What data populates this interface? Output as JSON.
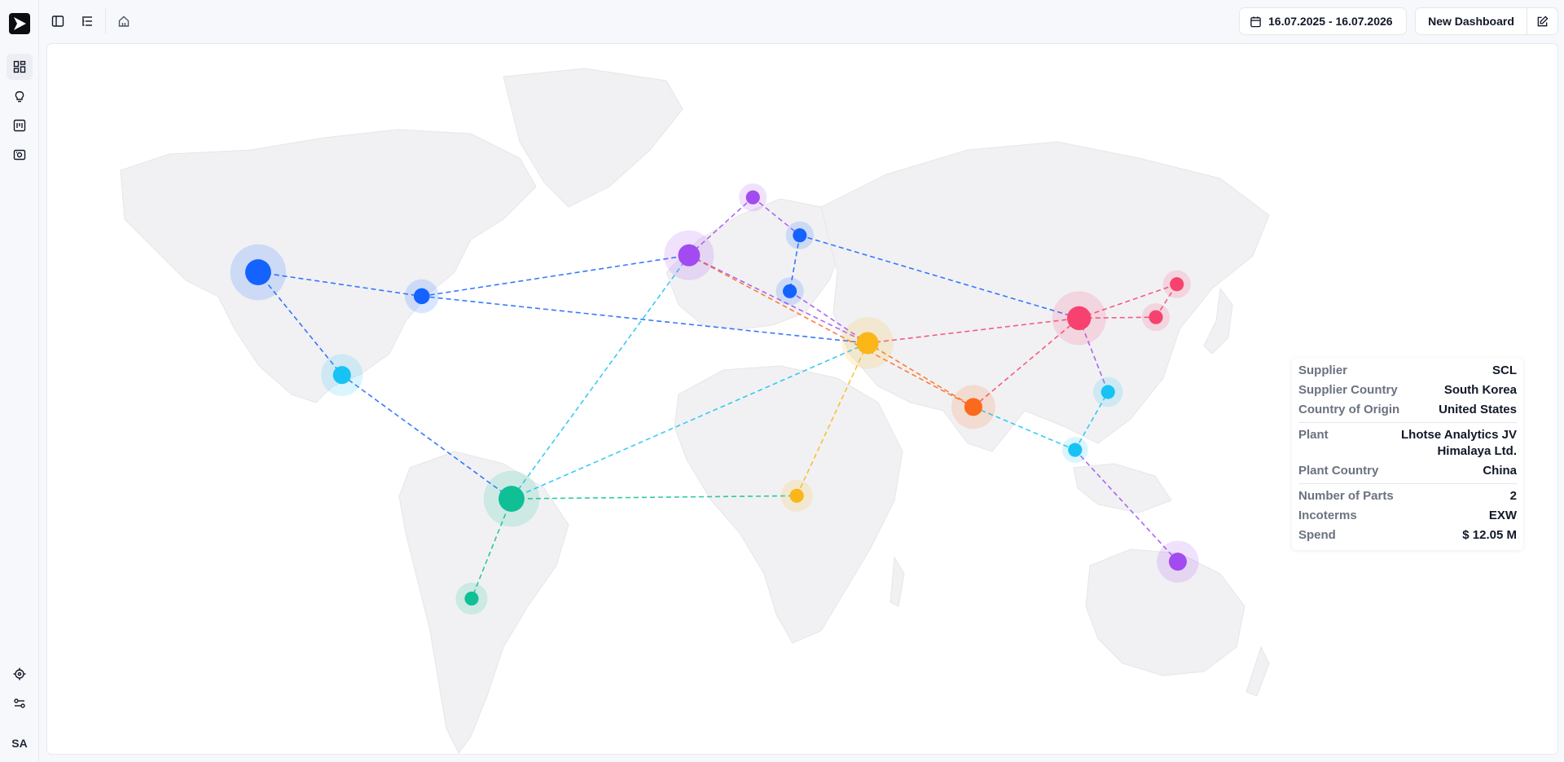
{
  "sidebar": {
    "logo": "brand-logo",
    "items": [
      {
        "name": "dashboards",
        "icon": "dashboard-icon",
        "active": true
      },
      {
        "name": "insights",
        "icon": "lightbulb-icon",
        "active": false
      },
      {
        "name": "reports",
        "icon": "board-icon",
        "active": false
      },
      {
        "name": "scan",
        "icon": "scan-icon",
        "active": false
      }
    ],
    "bottom_items": [
      {
        "name": "target",
        "icon": "target-icon"
      },
      {
        "name": "settings",
        "icon": "sliders-icon"
      }
    ],
    "avatar_initials": "SA"
  },
  "toolbar": {
    "date_range": "16.07.2025 - 16.07.2026",
    "new_dashboard_label": "New Dashboard"
  },
  "tooltip": {
    "supplier_label": "Supplier",
    "supplier": "SCL",
    "supplier_country_label": "Supplier Country",
    "supplier_country": "South Korea",
    "origin_label": "Country of Origin",
    "origin": "United States",
    "plant_label": "Plant",
    "plant_line1": "Lhotse Analytics JV",
    "plant_line2": "Himalaya Ltd.",
    "plant_country_label": "Plant Country",
    "plant_country": "China",
    "parts_label": "Number of Parts",
    "parts": "2",
    "incoterms_label": "Incoterms",
    "incoterms": "EXW",
    "spend_label": "Spend",
    "spend": "$ 12.05 M"
  },
  "colors": {
    "blue": "#1463ff",
    "cyan": "#17c3f5",
    "teal": "#0fbf96",
    "purple": "#a24bf0",
    "yellow": "#fbb617",
    "orange": "#fb6a1c",
    "pink": "#f7426f"
  }
}
